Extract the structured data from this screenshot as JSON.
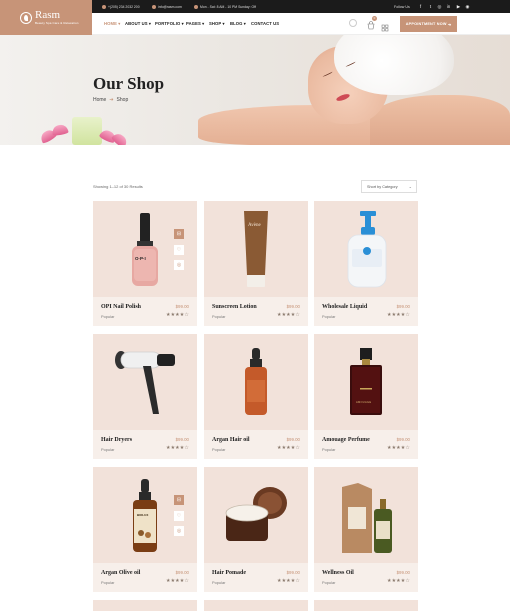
{
  "brand": {
    "name": "Rasm",
    "tagline": "Beauty Spa Care & Relaxation"
  },
  "topbar": {
    "phone": "+(205) 234 2032 200",
    "email": "info@rasm.com",
    "hours": "Mon - Sat: 8 AM - 10 PM Sunday: Off",
    "follow_label": "Follow Us",
    "socials": [
      "facebook-icon",
      "twitter-icon",
      "instagram-icon",
      "linkedin-icon",
      "youtube-icon",
      "rss-icon"
    ]
  },
  "nav": {
    "items": [
      {
        "label": "HOME",
        "active": true
      },
      {
        "label": "ABOUT US",
        "active": false
      },
      {
        "label": "PORTFOLIO",
        "active": false
      },
      {
        "label": "PAGES",
        "active": false
      },
      {
        "label": "SHOP",
        "active": false
      },
      {
        "label": "BLOG",
        "active": false
      },
      {
        "label": "CONTACT US",
        "active": false
      }
    ],
    "cart_count": "0",
    "appointment_label": "APPOINTMENT NOW"
  },
  "hero": {
    "title": "Our Shop",
    "breadcrumb": {
      "home": "Home",
      "current": "Shop"
    }
  },
  "shop": {
    "results_text": "Showing 1–12 of 30 Results",
    "sort_label": "Short by Category",
    "products": [
      {
        "name": "OPI Nail Polish",
        "price": "$99.00",
        "category": "Popular",
        "stars": "★★★★☆"
      },
      {
        "name": "Sunscreen Lotion",
        "price": "$99.00",
        "category": "Popular",
        "stars": "★★★★☆"
      },
      {
        "name": "Wholesale Liquid",
        "price": "$99.00",
        "category": "Popular",
        "stars": "★★★★☆"
      },
      {
        "name": "Hair Dryers",
        "price": "$99.00",
        "category": "Popular",
        "stars": "★★★★☆"
      },
      {
        "name": "Argan Hair oil",
        "price": "$99.00",
        "category": "Popular",
        "stars": "★★★★☆"
      },
      {
        "name": "Amouage Perfume",
        "price": "$99.00",
        "category": "Popular",
        "stars": "★★★★☆"
      },
      {
        "name": "Argan Olive oil",
        "price": "$99.00",
        "category": "Popular",
        "stars": "★★★★☆"
      },
      {
        "name": "Hair Pomade",
        "price": "$99.00",
        "category": "Popular",
        "stars": "★★★★☆"
      },
      {
        "name": "Wellness Oil",
        "price": "$99.00",
        "category": "Popular",
        "stars": "★★★★☆"
      }
    ],
    "product_art": {
      "nail_label": "O·P·I",
      "lotion_label": "Avène",
      "perfume_label": "AMOUAGE",
      "oil_label": "BIOLUX"
    }
  },
  "colors": {
    "accent": "#c79478",
    "dark": "#1b1b1b",
    "card_bg": "#f2e2da"
  }
}
